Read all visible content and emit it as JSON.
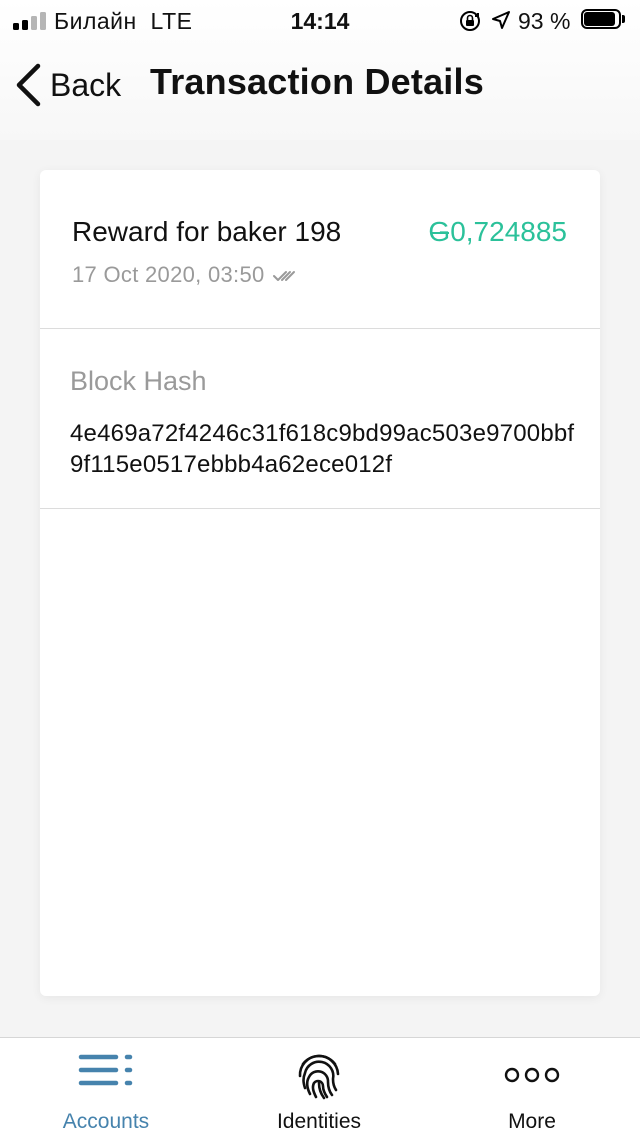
{
  "status_bar": {
    "carrier": "Билайн",
    "network": "LTE",
    "time": "14:14",
    "battery": "93 %"
  },
  "nav": {
    "back_label": "Back",
    "title": "Transaction Details"
  },
  "transaction": {
    "title": "Reward for baker 198",
    "amount_symbol": "G",
    "amount_value": "0,724885",
    "amount_color": "#2bc19a",
    "date": "17 Oct 2020, 03:50",
    "status_icon": "double-check-icon"
  },
  "block_hash": {
    "label": "Block Hash",
    "value": "4e469a72f4246c31f618c9bd99ac503e9700bbf9f115e0517ebbb4a62ece012f"
  },
  "tab_bar": {
    "accent_color": "#4683ad",
    "tabs": [
      {
        "label": "Accounts",
        "icon": "accounts-list-icon",
        "active": true
      },
      {
        "label": "Identities",
        "icon": "fingerprint-icon",
        "active": false
      },
      {
        "label": "More",
        "icon": "more-dots-icon",
        "active": false
      }
    ]
  }
}
